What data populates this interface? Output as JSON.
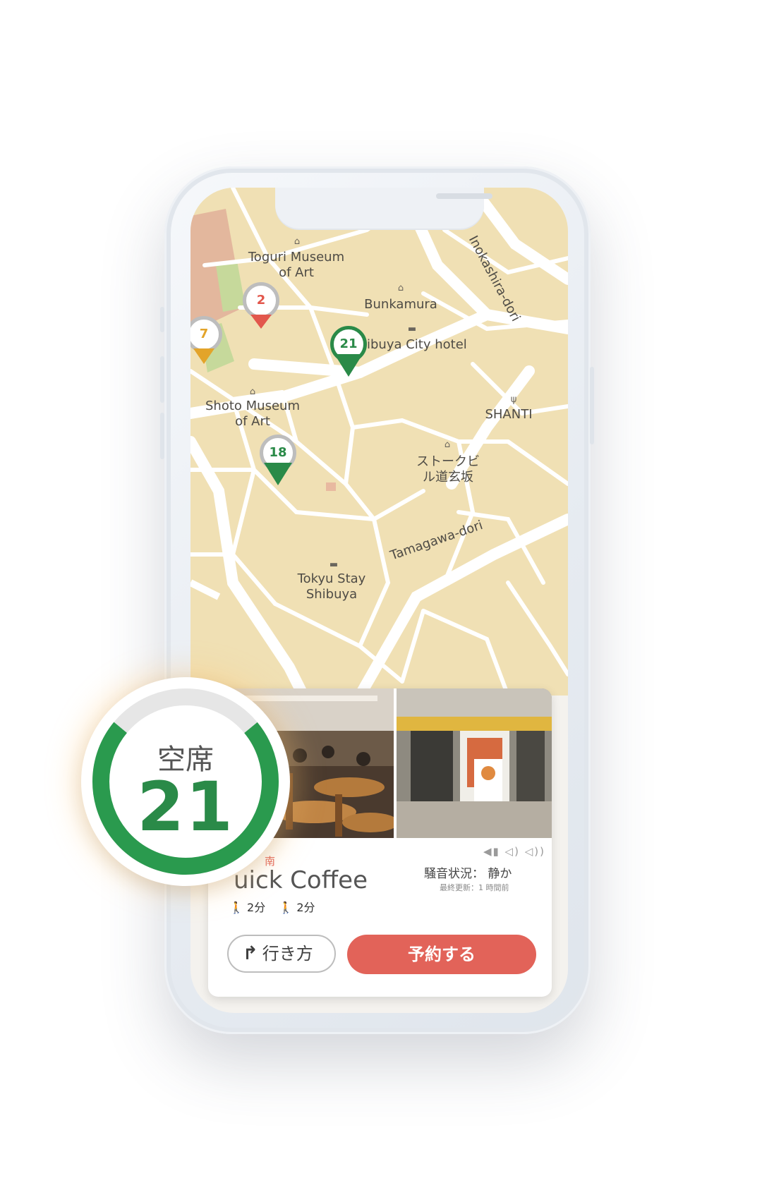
{
  "map": {
    "labels": {
      "toguri_1": "Toguri Museum",
      "toguri_2": "of Art",
      "bunkamura": "Bunkamura",
      "hotel": "ibuya City hotel",
      "shoto_1": "Shoto Museum",
      "shoto_2": "of Art",
      "shanti": "SHANTI",
      "stoke_1": "ストークビ",
      "stoke_2": "ル道玄坂",
      "tokyu_1": "Tokyu Stay",
      "tokyu_2": "Shibuya",
      "inokashira": "Inokashira-dori",
      "tamagawa": "Tamagawa-dori"
    },
    "pins": [
      {
        "count": "2",
        "status": "red",
        "color": "#e2574c"
      },
      {
        "count": "7",
        "status": "orange",
        "color": "#e3a42a"
      },
      {
        "count": "21",
        "status": "green",
        "color": "#2a8a48"
      },
      {
        "count": "18",
        "status": "green",
        "color": "#2a8a48"
      }
    ]
  },
  "gauge": {
    "label": "空席",
    "count": "21",
    "fill_fraction": 0.72,
    "color": "#2a9a4e"
  },
  "card": {
    "area": "南",
    "name": "uick Coffee",
    "walk_1": "2分",
    "walk_2": "2分",
    "noise": "騒音状況： 静か",
    "updated": "最終更新：1 時間前"
  },
  "buttons": {
    "route": "行き方",
    "reserve": "予約する"
  },
  "colors": {
    "accent": "#e26359",
    "green": "#2a8a48",
    "map_bg": "#f0e0b4",
    "road": "#ffffff"
  }
}
